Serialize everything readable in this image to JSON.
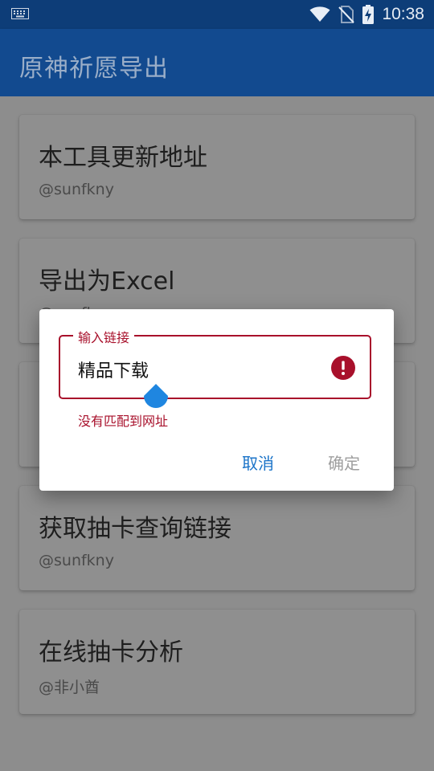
{
  "status_bar": {
    "time": "10:38",
    "icons": [
      "keyboard-icon",
      "wifi-icon",
      "no-sim-icon",
      "battery-charging-icon"
    ]
  },
  "app_bar": {
    "title": "原神祈愿导出"
  },
  "cards": [
    {
      "title": "本工具更新地址",
      "subtitle": "@sunfkny"
    },
    {
      "title": "导出为Excel",
      "subtitle": "@sunfkny"
    },
    {
      "title": "",
      "subtitle": ""
    },
    {
      "title": "获取抽卡查询链接",
      "subtitle": "@sunfkny"
    },
    {
      "title": "在线抽卡分析",
      "subtitle": "@非小酋"
    }
  ],
  "dialog": {
    "field_label": "输入链接",
    "field_value": "精品下载",
    "error_text": "没有匹配到网址",
    "cancel_label": "取消",
    "confirm_label": "确定"
  },
  "colors": {
    "status_bar": "#0d3d78",
    "app_bar": "#124a8f",
    "error": "#a8102b",
    "accent": "#1a73c8",
    "disabled": "#9e9e9e"
  }
}
